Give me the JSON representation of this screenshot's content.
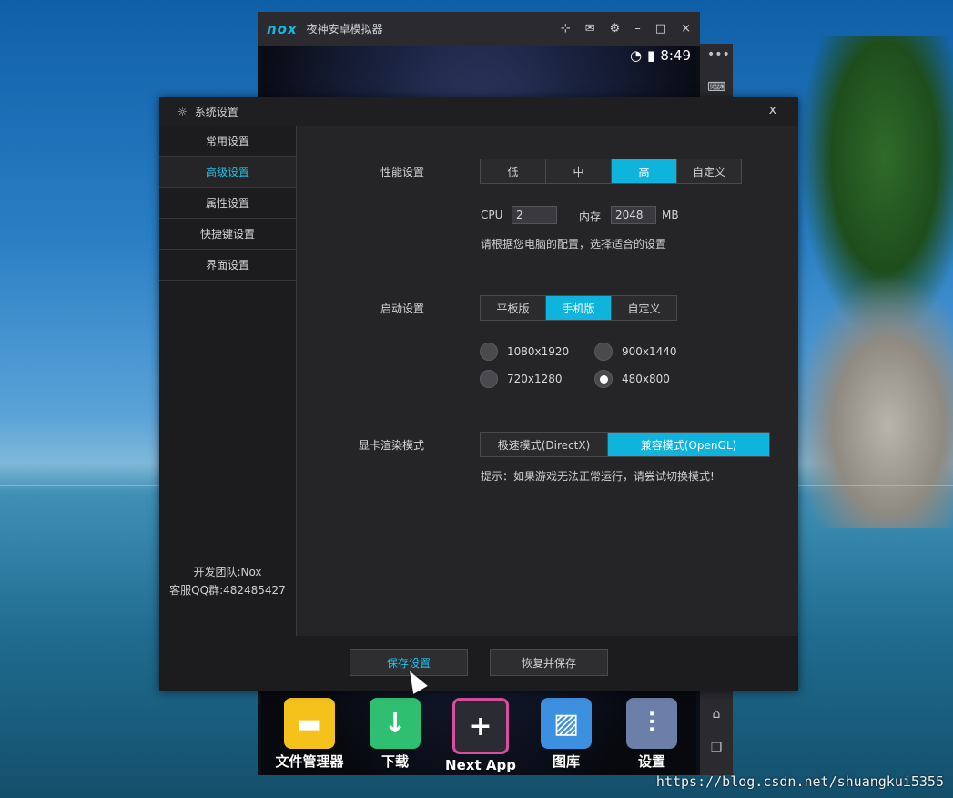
{
  "emulator": {
    "logo": "nox",
    "title": "夜神安卓模拟器",
    "status_time": "8:49",
    "toolbar_icons": [
      "pin-icon",
      "mail-icon",
      "gear-icon",
      "minimize-icon",
      "maximize-icon",
      "close-icon"
    ],
    "side_icons": [
      "more-icon",
      "keyboard-icon",
      "home-icon",
      "recent-apps-icon"
    ],
    "dock_apps": [
      {
        "label": "文件管理器",
        "icon": "folder-icon",
        "color": "#f5c21b"
      },
      {
        "label": "下载",
        "icon": "download-icon",
        "color": "#2fbf71"
      },
      {
        "label": "Next App",
        "icon": "plus-icon",
        "color": "#2b2b33"
      },
      {
        "label": "图库",
        "icon": "gallery-icon",
        "color": "#3d8fe0"
      },
      {
        "label": "设置",
        "icon": "sliders-icon",
        "color": "#6c7fa8"
      }
    ]
  },
  "dialog": {
    "title": "系统设置",
    "close": "x",
    "nav": [
      {
        "label": "常用设置",
        "active": false
      },
      {
        "label": "高级设置",
        "active": true
      },
      {
        "label": "属性设置",
        "active": false
      },
      {
        "label": "快捷键设置",
        "active": false
      },
      {
        "label": "界面设置",
        "active": false
      }
    ],
    "credits": {
      "team": "开发团队:Nox",
      "qq": "客服QQ群:482485427"
    },
    "performance": {
      "label": "性能设置",
      "options": [
        "低",
        "中",
        "高",
        "自定义"
      ],
      "selected": "高",
      "cpu_label": "CPU",
      "cpu_value": "2",
      "mem_label": "内存",
      "mem_value": "2048",
      "mem_unit": "MB",
      "hint": "请根据您电脑的配置，选择适合的设置"
    },
    "startup": {
      "label": "启动设置",
      "options": [
        "平板版",
        "手机版",
        "自定义"
      ],
      "selected": "手机版",
      "resolutions": [
        {
          "label": "1080x1920",
          "checked": false
        },
        {
          "label": "900x1440",
          "checked": false
        },
        {
          "label": "720x1280",
          "checked": false
        },
        {
          "label": "480x800",
          "checked": true
        }
      ]
    },
    "render": {
      "label": "显卡渲染模式",
      "options": [
        "极速模式(DirectX)",
        "兼容模式(OpenGL)"
      ],
      "selected": "兼容模式(OpenGL)",
      "hint": "提示：如果游戏无法正常运行，请尝试切换模式!"
    },
    "buttons": {
      "save": "保存设置",
      "restore": "恢复并保存"
    }
  },
  "watermark": "https://blog.csdn.net/shuangkui5355",
  "colors": {
    "accent": "#0fb4dd",
    "dialog_bg": "#252528"
  }
}
